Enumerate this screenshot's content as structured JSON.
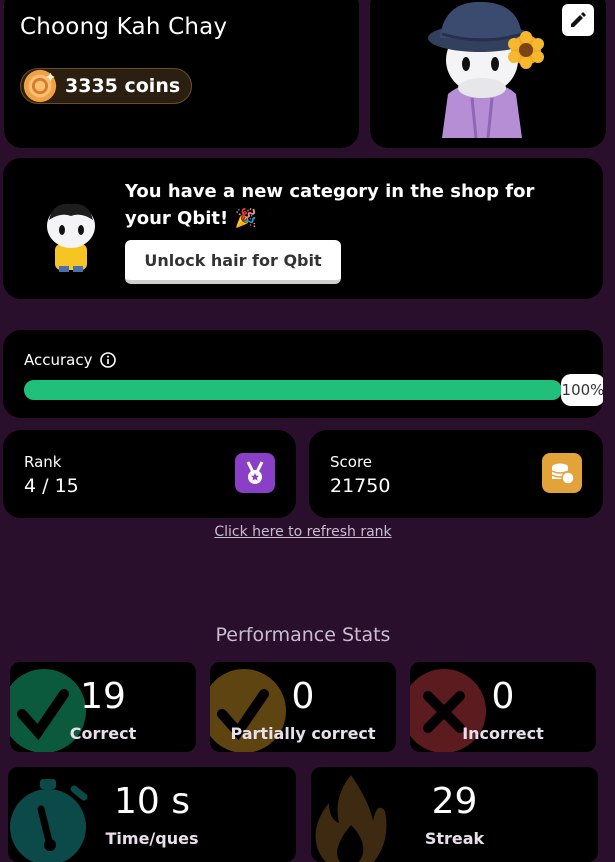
{
  "profile": {
    "name": "Choong Kah Chay",
    "coins_label": "3335 coins"
  },
  "shop": {
    "message": "You have a new category in the shop for your Qbit! 🎉",
    "button_label": "Unlock hair for Qbit"
  },
  "accuracy": {
    "label": "Accuracy",
    "value_label": "100%",
    "value": 1.0,
    "color": "#21c07a"
  },
  "rank": {
    "label": "Rank",
    "value": "4 / 15"
  },
  "score": {
    "label": "Score",
    "value": "21750"
  },
  "refresh_link": "Click here to refresh rank",
  "performance": {
    "title": "Performance Stats",
    "correct": {
      "value": "19",
      "label": "Correct"
    },
    "partial": {
      "value": "0",
      "label": "Partially correct"
    },
    "incorrect": {
      "value": "0",
      "label": "Incorrect"
    },
    "time": {
      "value": "10 s",
      "label": "Time/ques"
    },
    "streak": {
      "value": "29",
      "label": "Streak"
    }
  },
  "icons": [
    "coin-icon",
    "edit-icon",
    "info-icon",
    "medal-icon",
    "coins-stack-icon",
    "check-icon",
    "cross-icon",
    "stopwatch-icon",
    "flame-icon"
  ]
}
